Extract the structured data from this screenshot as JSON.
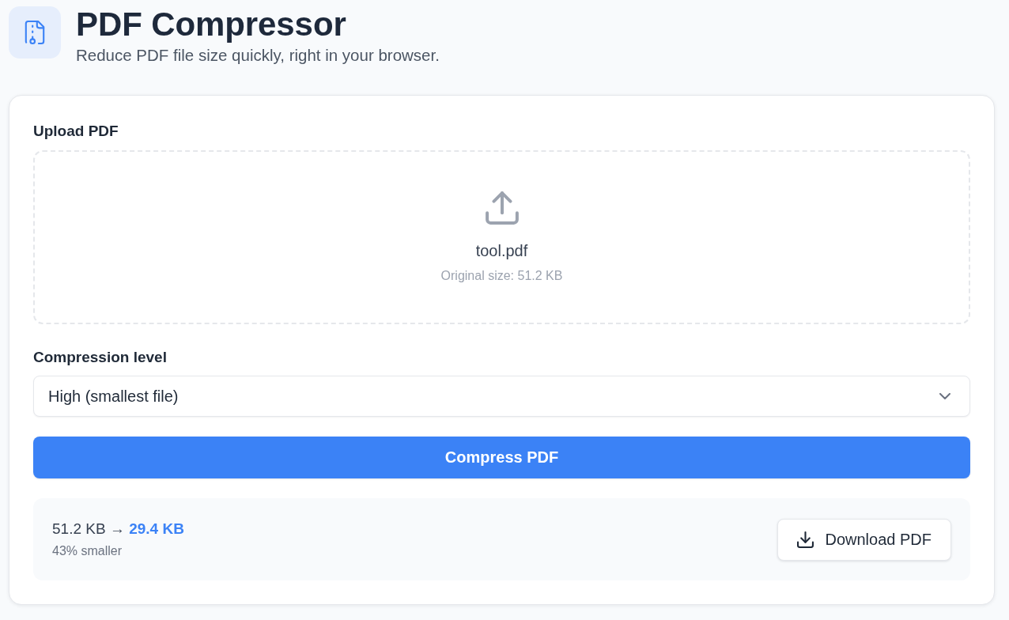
{
  "header": {
    "title": "PDF Compressor",
    "subtitle": "Reduce PDF file size quickly, right in your browser."
  },
  "upload": {
    "label": "Upload PDF",
    "file_name": "tool.pdf",
    "file_info": "Original size: 51.2 KB"
  },
  "compression": {
    "label": "Compression level",
    "value": "High (smallest file)"
  },
  "compress_button": {
    "label": "Compress PDF"
  },
  "result": {
    "summary": "51.2 KB → **29.4 KB**",
    "reduction": "43% smaller",
    "download_button": {
      "label": "Download PDF"
    }
  }
}
